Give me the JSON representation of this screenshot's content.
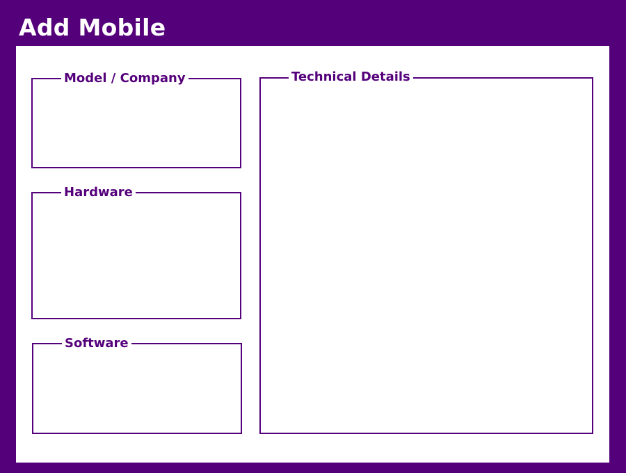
{
  "window": {
    "title": "Add Mobile"
  },
  "groups": {
    "model_company": {
      "label": "Model / Company"
    },
    "hardware": {
      "label": "Hardware"
    },
    "software": {
      "label": "Software"
    },
    "technical_details": {
      "label": "Technical Details"
    }
  },
  "colors": {
    "accent": "#55007b",
    "panel_background": "#ffffff",
    "title_text": "#ffffff"
  }
}
